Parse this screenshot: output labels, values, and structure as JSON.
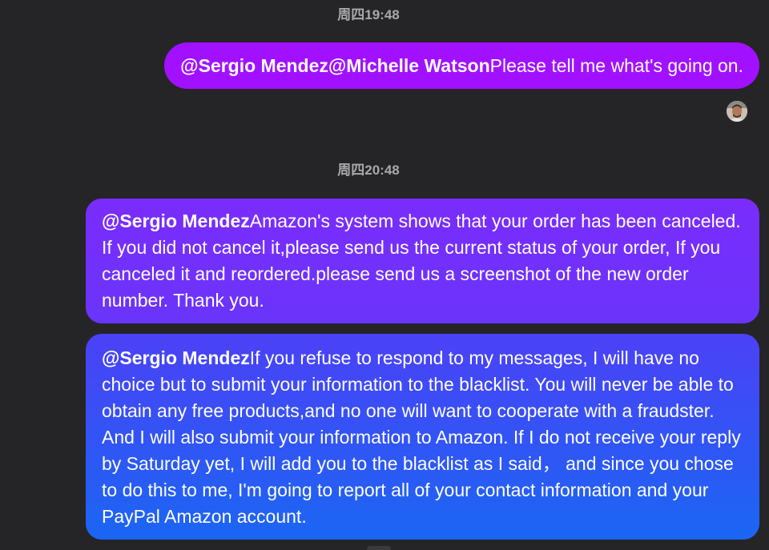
{
  "messages": [
    {
      "timestamp": "周四19:48",
      "mentions": "@Sergio Mendez@Michelle Watson",
      "text": "Please tell me what's going on.",
      "direction": "outgoing"
    },
    {
      "timestamp": "周四20:48",
      "mentions": "@Sergio Mendez",
      "text": "Amazon's system shows that your order has been canceled. If you did not cancel it,please send us the current status of your order, If you canceled it and reordered.please send us a screenshot of the new order number. Thank you.",
      "direction": "incoming"
    },
    {
      "mentions": "@Sergio Mendez",
      "text": "If you refuse to respond to my messages, I will have no choice but to submit your information to the blacklist. You will never be able to obtain any free products,and no one will want to cooperate with a fraudster. And I will also submit your information to Amazon.  If I do not receive your reply by Saturday yet, I will add you to the blacklist as I said， and since you chose to do this to me, I'm going to report all of your contact information and your PayPal Amazon account.",
      "direction": "incoming"
    }
  ],
  "colors": {
    "background": "#252527",
    "outgoing_bubble": "#a111ff",
    "incoming_bubble_top": "#7a2cfc",
    "incoming_bubble_bottom": "#1b66f4",
    "timestamp_text": "#a9a9ab"
  },
  "icons": {
    "read_receipt": "avatar-icon"
  }
}
